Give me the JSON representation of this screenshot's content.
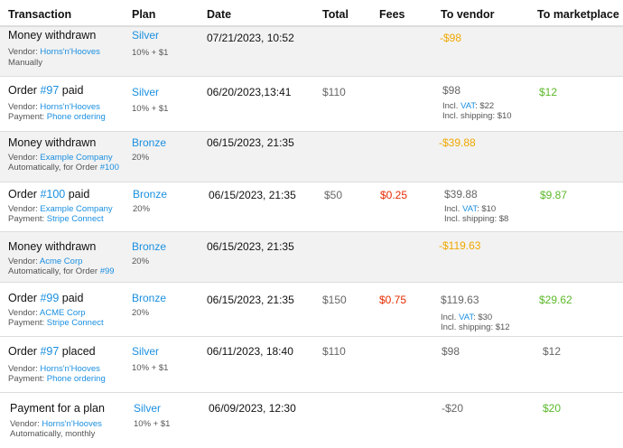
{
  "columns": {
    "transaction": "Transaction",
    "plan": "Plan",
    "date": "Date",
    "total": "Total",
    "fees": "Fees",
    "to_vendor": "To vendor",
    "to_marketplace": "To marketplace"
  },
  "rows": [
    {
      "title_text": "Money withdrawn",
      "line1_prefix": "Vendor: ",
      "line1_link": "Horns'n'Hooves",
      "line2_text": "Manually",
      "plan_name": "Silver",
      "plan_fee": "10% + $1",
      "date": "07/21/2023, 10:52",
      "to_vendor": "-$98"
    },
    {
      "title_pre": "Order ",
      "title_link": "#97",
      "title_post": " paid",
      "line1_prefix": "Vendor: ",
      "line1_link": "Horns'n'Hooves",
      "line2_prefix": "Payment: ",
      "line2_link": "Phone ordering",
      "plan_name": "Silver",
      "plan_fee": "10% + $1",
      "date": "06/20/2023,13:41",
      "total": "$110",
      "to_vendor": "$98",
      "vat_pre": "Incl. ",
      "vat_link": "VAT",
      "vat_post": ": $22",
      "shipping": "Incl. shipping: $10",
      "to_marketplace": "$12"
    },
    {
      "title_text": "Money withdrawn",
      "line1_prefix": "Vendor: ",
      "line1_link": "Example Company",
      "line2_prefix": "Automatically, for Order ",
      "line2_link": "#100",
      "plan_name": "Bronze",
      "plan_fee": "20%",
      "date": "06/15/2023, 21:35",
      "to_vendor": "-$39.88"
    },
    {
      "title_pre": "Order ",
      "title_link": "#100",
      "title_post": " paid",
      "line1_prefix": "Vendor: ",
      "line1_link": "Example Company",
      "line2_prefix": "Payment: ",
      "line2_link": "Stripe Connect",
      "plan_name": "Bronze",
      "plan_fee": "20%",
      "date": "06/15/2023, 21:35",
      "total": "$50",
      "fees": "$0.25",
      "to_vendor": "$39.88",
      "vat_pre": "Incl. ",
      "vat_link": "VAT",
      "vat_post": ": $10",
      "shipping": "Incl. shipping: $8",
      "to_marketplace": "$9.87"
    },
    {
      "title_text": "Money withdrawn",
      "line1_prefix": "Vendor: ",
      "line1_link": "Acme Corp",
      "line2_prefix": "Automatically, for Order ",
      "line2_link": "#99",
      "plan_name": "Bronze",
      "plan_fee": "20%",
      "date": "06/15/2023, 21:35",
      "to_vendor": "-$119.63"
    },
    {
      "title_pre": "Order ",
      "title_link": "#99",
      "title_post": " paid",
      "line1_prefix": "Vendor: ",
      "line1_link": "ACME Corp",
      "line2_prefix": "Payment: ",
      "line2_link": "Stripe Connect",
      "plan_name": "Bronze",
      "plan_fee": "20%",
      "date": "06/15/2023, 21:35",
      "total": "$150",
      "fees": "$0.75",
      "to_vendor": "$119.63",
      "vat_pre": "Incl. ",
      "vat_link": "VAT",
      "vat_post": ": $30",
      "shipping": "Incl. shipping: $12",
      "to_marketplace": "$29.62"
    },
    {
      "title_pre": "Order ",
      "title_link": "#97",
      "title_post": " placed",
      "line1_prefix": "Vendor: ",
      "line1_link": "Horns'n'Hooves",
      "line2_prefix": "Payment: ",
      "line2_link": "Phone ordering",
      "plan_name": "Silver",
      "plan_fee": "10% + $1",
      "date": "06/11/2023, 18:40",
      "total": "$110",
      "to_vendor": "$98",
      "to_marketplace": "$12"
    },
    {
      "title_text": "Payment for a plan",
      "line1_prefix": "Vendor: ",
      "line1_link": "Horns'n'Hooves",
      "line2_text": "Automatically, monthly",
      "plan_name": "Silver",
      "plan_fee": "10% + $1",
      "date": "06/09/2023, 12:30",
      "to_vendor": "-$20",
      "to_marketplace": "$20"
    }
  ],
  "colors": {
    "link": "#1a8fe0",
    "negative_vendor": "#f0a800",
    "fee": "#e62b00",
    "positive_marketplace": "#5cb82a",
    "row_shade": "#f2f2f2"
  }
}
